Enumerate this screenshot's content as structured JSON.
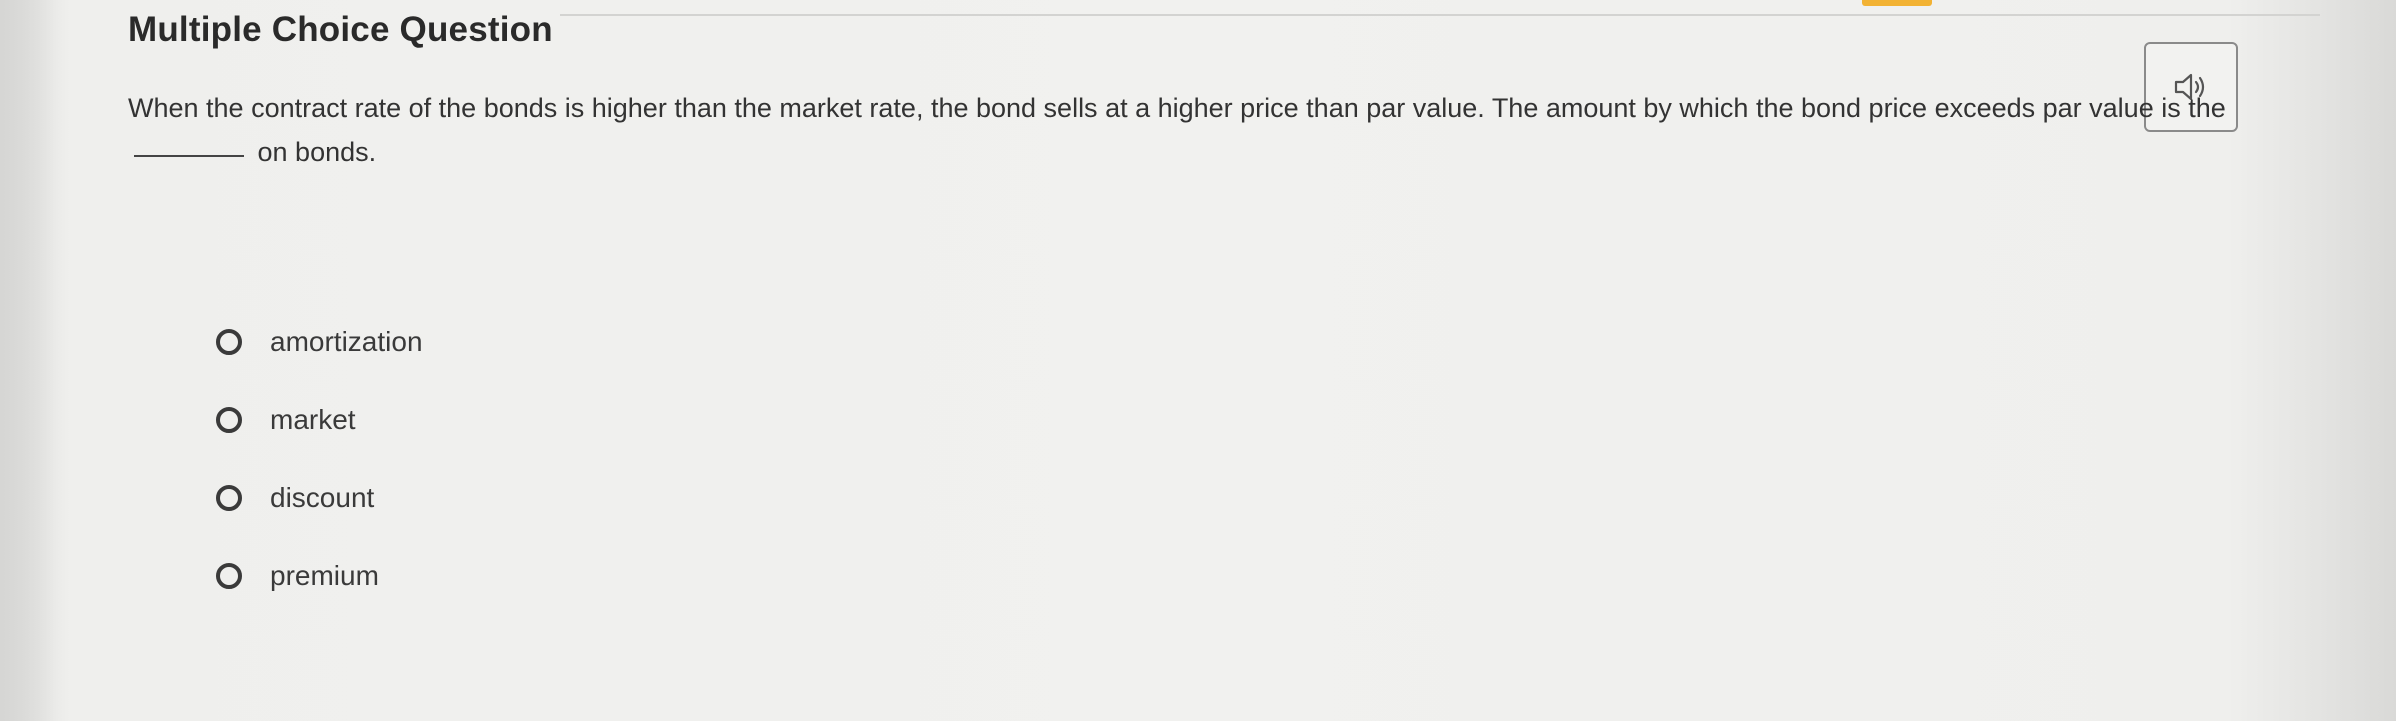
{
  "question": {
    "title": "Multiple Choice Question",
    "text_before_blank": "When the contract rate of the bonds is higher than the market rate, the bond sells at a higher price than par value. The amount by which the bond price exceeds par value is the",
    "text_after_blank": "on bonds."
  },
  "audio": {
    "icon": "speaker-icon"
  },
  "options": [
    {
      "label": "amortization"
    },
    {
      "label": "market"
    },
    {
      "label": "discount"
    },
    {
      "label": "premium"
    }
  ],
  "colors": {
    "accent": "#f2b233",
    "text": "#333333"
  }
}
